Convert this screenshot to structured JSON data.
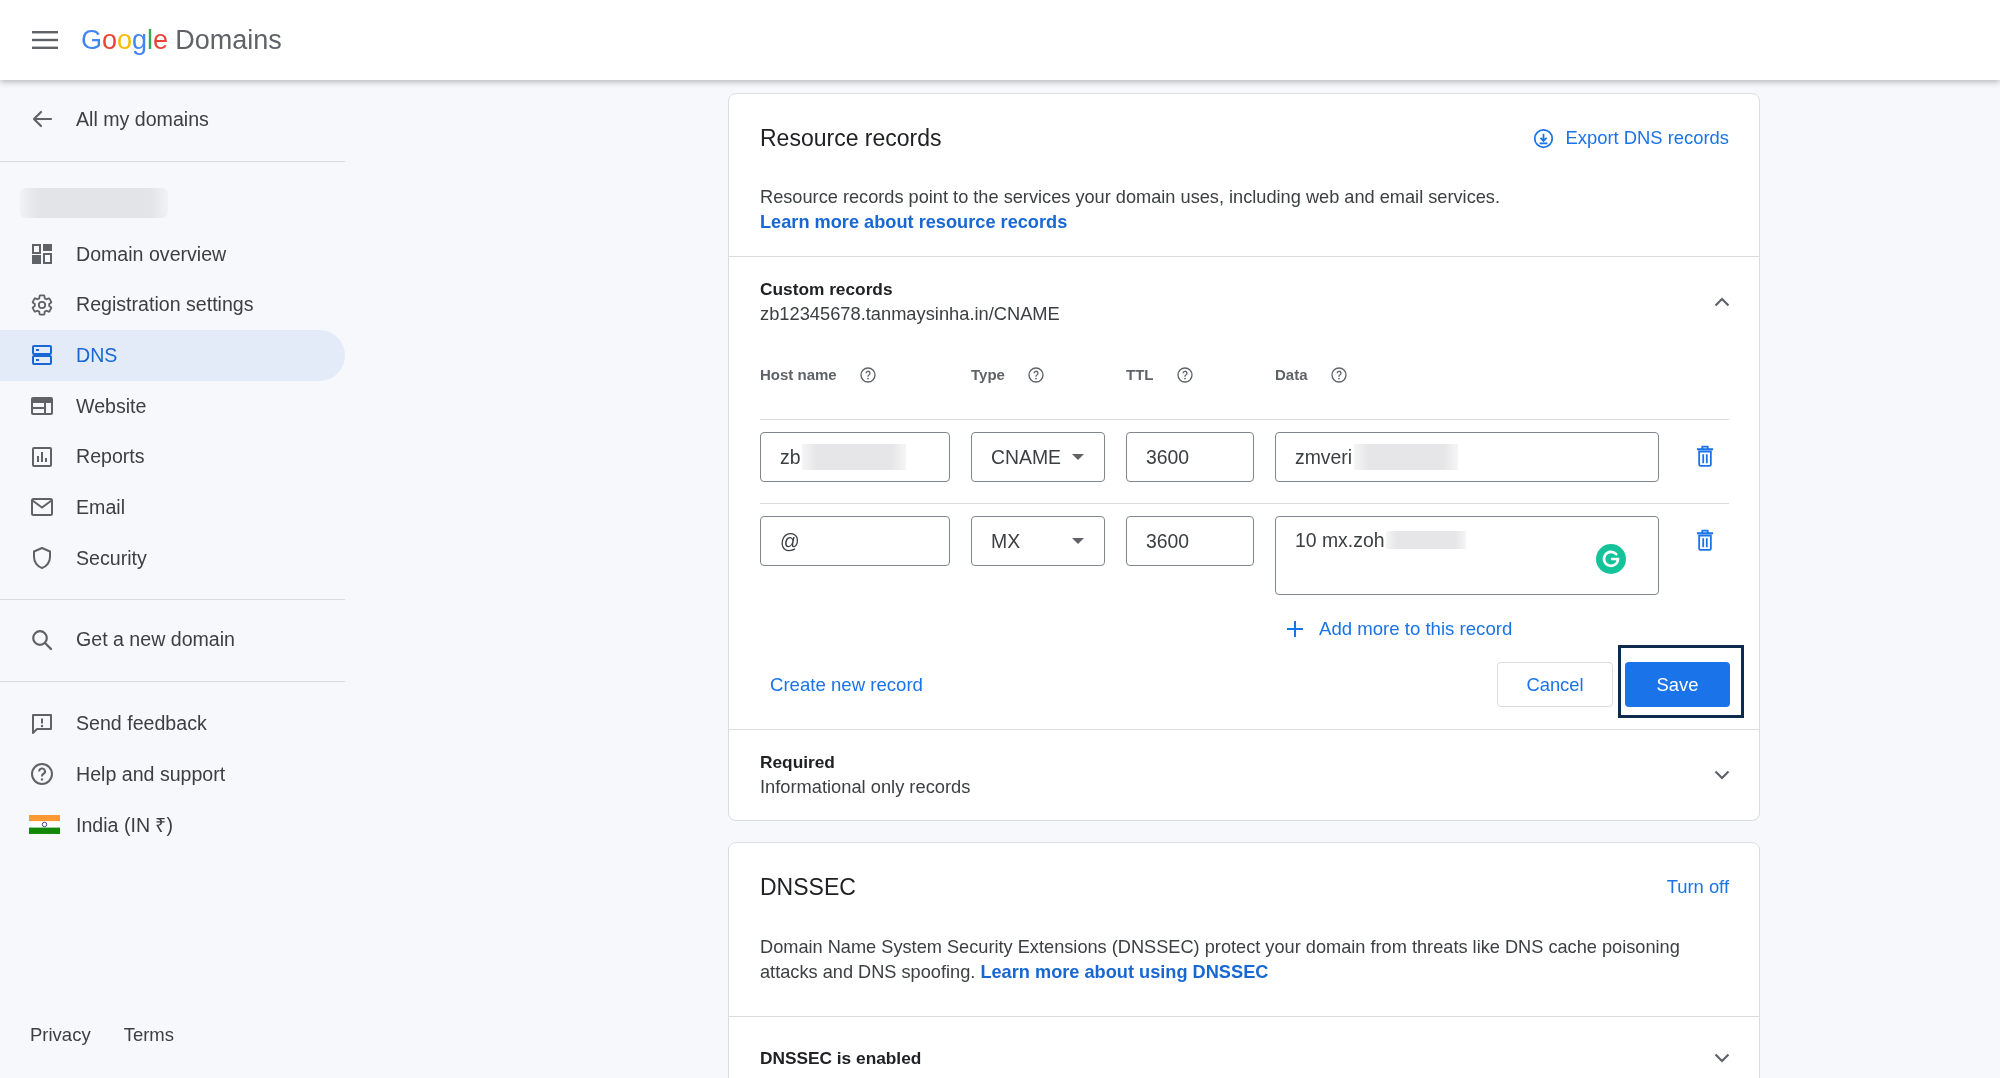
{
  "header": {
    "logo": {
      "brand": "Google",
      "product": "Domains"
    }
  },
  "sidebar": {
    "back_link": "All my domains",
    "domain_name_redacted": true,
    "nav_items": [
      {
        "label": "Domain overview",
        "selected": false
      },
      {
        "label": "Registration settings",
        "selected": false
      },
      {
        "label": "DNS",
        "selected": true
      },
      {
        "label": "Website",
        "selected": false
      },
      {
        "label": "Reports",
        "selected": false
      },
      {
        "label": "Email",
        "selected": false
      },
      {
        "label": "Security",
        "selected": false
      }
    ],
    "search_link": "Get a new domain",
    "help_items": [
      "Send feedback",
      "Help and support"
    ],
    "region": "India (IN ₹)",
    "footer_links": [
      "Privacy",
      "Terms"
    ]
  },
  "resource_records": {
    "title": "Resource records",
    "export_link": "Export DNS records",
    "description": "Resource records point to the services your domain uses, including web and email services.",
    "learn_more_link": "Learn more about resource records",
    "custom_records": {
      "title": "Custom records",
      "subtitle": "zb12345678.tanmaysinha.in/CNAME",
      "expanded": true,
      "columns": [
        "Host name",
        "Type",
        "TTL",
        "Data"
      ],
      "rows": [
        {
          "host_name": "zb",
          "host_redacted": true,
          "type": "CNAME",
          "ttl": "3600",
          "data": "zmveri",
          "data_redacted": true,
          "multiline": false,
          "assistant_badge": false
        },
        {
          "host_name": "@",
          "host_redacted": false,
          "type": "MX",
          "ttl": "3600",
          "data": "10 mx.zoh",
          "data_redacted": true,
          "multiline": true,
          "assistant_badge": true
        }
      ],
      "add_more_link": "Add more to this record",
      "create_link": "Create new record",
      "cancel_button": "Cancel",
      "save_button": {
        "label": "Save",
        "focused": true
      }
    },
    "required": {
      "title": "Required",
      "subtitle": "Informational only records",
      "expanded": false
    }
  },
  "dnssec": {
    "title": "DNSSEC",
    "turn_off_link": "Turn off",
    "description": "Domain Name System Security Extensions (DNSSEC) protect your domain from threats like DNS cache poisoning attacks and DNS spoofing.",
    "learn_more_link": "Learn more about using DNSSEC",
    "status": {
      "title": "DNSSEC is enabled",
      "expanded": false
    }
  }
}
